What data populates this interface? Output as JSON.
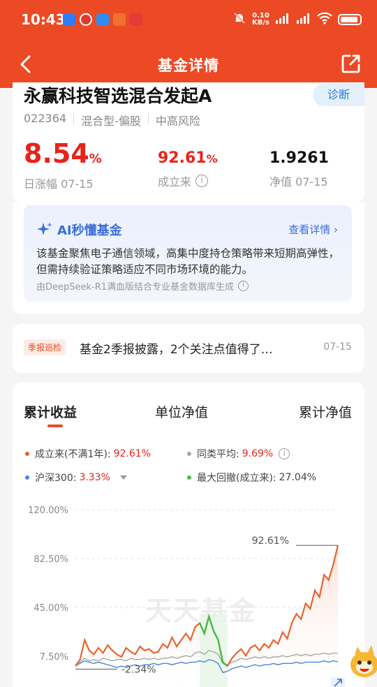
{
  "status_bar": {
    "time": "10:43",
    "speed_value": "0.10",
    "speed_unit": "KB/s",
    "sig1": "5G",
    "sig2": "5G"
  },
  "nav": {
    "title": "基金详情"
  },
  "fund": {
    "name": "永赢科技智选混合发起A",
    "diagnose": "诊断",
    "code": "022364",
    "type": "混合型-偏股",
    "risk": "中高风险",
    "daily_change": "8.54",
    "daily_change_unit": "%",
    "daily_change_label": "日涨幅 07-15",
    "since_inception": "92.61",
    "since_inception_unit": "%",
    "since_inception_label": "成立来",
    "nav_value": "1.9261",
    "nav_label": "净值 07-15"
  },
  "ai": {
    "title": "AI秒懂基金",
    "more": "查看详情",
    "text": "该基金聚焦电子通信领域，高集中度持仓策略带来短期高弹性，但需持续验证策略适应不同市场环境的能力。",
    "footnote": "由DeepSeek-R1满血版结合专业基金数据库生成"
  },
  "news": {
    "tag": "季报巡检",
    "title": "基金2季报披露，2个关注点值得了…",
    "date": "07-15"
  },
  "chart_tabs": [
    "累计收益",
    "单位净值",
    "累计净值"
  ],
  "legend": {
    "fund_label": "成立来(不满1年):",
    "fund_value": "92.61%",
    "peer_label": "同类平均:",
    "peer_value": "9.69%",
    "hs300_label": "沪深300:",
    "hs300_value": "3.33%",
    "drawdown_label": "最大回撤(成立来):",
    "drawdown_value": "27.04%"
  },
  "watermark": "天天基金",
  "colors": {
    "brand": "#ec4a25",
    "fund_line": "#e9632f",
    "peer_line": "#a6a6a6",
    "hs300_line": "#4a86d6",
    "drawdown": "#4cb84c",
    "up": "#e8231a"
  },
  "chart_data": {
    "type": "line",
    "yticks": [
      "120.00%",
      "82.50%",
      "45.00%",
      "7.50%"
    ],
    "ylim": [
      -10,
      120
    ],
    "annotations": {
      "max": "92.61%",
      "min": "-2.34%"
    },
    "series": [
      {
        "name": "成立来(不满1年)",
        "values": [
          0,
          5,
          20,
          12,
          9,
          14,
          10,
          16,
          12,
          9,
          7,
          14,
          11,
          9,
          15,
          12,
          13,
          10,
          11,
          17,
          14,
          22,
          15,
          20,
          25,
          20,
          30,
          33,
          25,
          38,
          27,
          20,
          3,
          0,
          6,
          10,
          13,
          8,
          14,
          16,
          12,
          17,
          14,
          20,
          17,
          26,
          21,
          33,
          40,
          36,
          48,
          44,
          58,
          53,
          70,
          66,
          78,
          92.61
        ]
      },
      {
        "name": "同类平均",
        "values": [
          0,
          3,
          6,
          4,
          5,
          4,
          6,
          5,
          4,
          5,
          5,
          4,
          6,
          5,
          5,
          6,
          5,
          6,
          5,
          6,
          6,
          7,
          6,
          7,
          8,
          7,
          10,
          11,
          9,
          12,
          11,
          9,
          2,
          1,
          3,
          4,
          6,
          5,
          6,
          7,
          6,
          7,
          6,
          7,
          7,
          8,
          7,
          8,
          9,
          8,
          9,
          8,
          9,
          9,
          10,
          9,
          10,
          9.69
        ]
      },
      {
        "name": "沪深300",
        "values": [
          0,
          2,
          4,
          3,
          2,
          3,
          2,
          1,
          0,
          -1,
          0,
          -1,
          0,
          1,
          0,
          1,
          1,
          2,
          1,
          2,
          2,
          1,
          2,
          3,
          2,
          3,
          3,
          4,
          3,
          5,
          4,
          2,
          -5,
          -4,
          -2,
          -1,
          0,
          -1,
          0,
          1,
          0,
          1,
          1,
          2,
          1,
          2,
          2,
          2,
          3,
          2,
          3,
          3,
          3,
          3,
          4,
          3,
          4,
          3.33
        ]
      }
    ]
  }
}
